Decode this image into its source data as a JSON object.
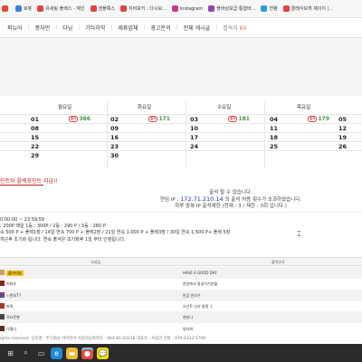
{
  "bookmarks": [
    {
      "label": "",
      "color": "#e34a2b"
    },
    {
      "label": "로봇",
      "color": "#3f7de0"
    },
    {
      "label": "유세팅 폴렉스 - 체인",
      "color": "#e04444"
    },
    {
      "label": "센플룩스",
      "color": "#e04444"
    },
    {
      "label": "지비포키 : 다시보...",
      "color": "#e04444"
    },
    {
      "label": "Instagram",
      "color": "#c8398e"
    },
    {
      "label": "플바상보급 통합바...",
      "color": "#8e44ad"
    },
    {
      "label": "잔뱅",
      "color": "#2d9ae0"
    },
    {
      "label": "클래식보게 제이지 |...",
      "color": "#e04444"
    }
  ],
  "nav": {
    "items": [
      "퍼뉴어",
      "풍자먼",
      "다닝",
      "기타자막",
      "제휴업체",
      "광고문의",
      "전체 게시글"
    ],
    "online_label": "접속자",
    "online_count": "60"
  },
  "calendar": {
    "days": [
      "월요일",
      "화요일",
      "수요일",
      "목요일"
    ],
    "rows": [
      [
        {
          "n": "01",
          "c": "366"
        },
        {
          "n": "02",
          "c": "171"
        },
        {
          "n": "03",
          "c": "181"
        },
        {
          "n": "04",
          "c": "179"
        },
        {
          "n": "05",
          "c": ""
        }
      ],
      [
        {
          "n": "08",
          "c": ""
        },
        {
          "n": "09",
          "c": ""
        },
        {
          "n": "10",
          "c": ""
        },
        {
          "n": "11",
          "c": ""
        },
        {
          "n": "12",
          "c": ""
        }
      ],
      [
        {
          "n": "15",
          "c": ""
        },
        {
          "n": "16",
          "c": ""
        },
        {
          "n": "17",
          "c": ""
        },
        {
          "n": "18",
          "c": ""
        },
        {
          "n": "19",
          "c": ""
        }
      ],
      [
        {
          "n": "22",
          "c": ""
        },
        {
          "n": "23",
          "c": ""
        },
        {
          "n": "24",
          "c": ""
        },
        {
          "n": "25",
          "c": ""
        },
        {
          "n": "26",
          "c": ""
        }
      ],
      [
        {
          "n": "29",
          "c": ""
        },
        {
          "n": "30",
          "c": ""
        },
        {
          "n": "",
          "c": ""
        },
        {
          "n": "",
          "c": ""
        },
        {
          "n": "",
          "c": ""
        }
      ]
    ],
    "badge": "출석"
  },
  "link_text": "인트와 플렉포인트 지급!!",
  "notice": {
    "line1": "출석 할 수 없습니다.",
    "line2_prefix": "현임 IP : ",
    "ip": "172.71.210.14",
    "line2_suffix": " 의 출석 허용 횟수가 초과하였습니다.",
    "line3": "하루 중복 IP 출석제한 (현재 : 3 / 제한 : 3회 입니다.)"
  },
  "rules": [
    "0:00:00 ~ 23:59:59",
    ": 200P 매일 1등 : 300P / 2등 : 290 P / 3등 : 280 P",
    "속 500 P + 플렉1장 / 14일 연속 700 P + 플렉2장 / 21일 연속 1,000 P + 플렉3장 / 30일 연속 1,500 P+ 플렉 5장",
    "개근후 초기화 됩니다. 연속 출석은 초기화후 1일 부터 인정됩니다."
  ],
  "list": {
    "col1": "닉네임",
    "col2": "출석인사",
    "rows": [
      {
        "name": "플나티넘",
        "msg": "HAVE A GOOD DAY",
        "color": "#c9a35a",
        "highlight": true
      },
      {
        "name": "지테슈",
        "msg": "한달에서 팡글이기분월",
        "color": "#8b2222",
        "highlight": false
      },
      {
        "name": "느렌보77",
        "msg": "반감 반오우",
        "color": "#6a4a8a",
        "highlight": false
      },
      {
        "name": "파며",
        "msg": "오인트 신라 발명 :)",
        "color": "#aa3333",
        "highlight": false
      },
      {
        "name": "목요문행",
        "msg": "한분나",
        "color": "#444444",
        "highlight": false
      },
      {
        "name": "나뭘디",
        "msg": "방라워",
        "color": "#553322",
        "highlight": false
      }
    ]
  },
  "footer": "ights reserved.   상호명 : 주식회사 아이퓨어   사업자등록번호 : 664-81-03118  대표자 : 서동민  전화 : 070-4333-5709",
  "taskbar": [
    {
      "name": "windows-start-icon",
      "color": "#3a8ee6",
      "glyph": "⊞"
    },
    {
      "name": "search-icon",
      "color": "#444",
      "glyph": "⌕"
    },
    {
      "name": "task-view-icon",
      "color": "#444",
      "glyph": "▭"
    },
    {
      "name": "edge-icon",
      "color": "#1f8ad6",
      "glyph": "e"
    },
    {
      "name": "explorer-icon",
      "color": "#e8b93a",
      "glyph": "▬"
    },
    {
      "name": "chrome-icon",
      "color": "#e84a3a",
      "glyph": "●"
    },
    {
      "name": "kakaotalk-icon",
      "color": "#f9e000",
      "glyph": "💬"
    }
  ]
}
